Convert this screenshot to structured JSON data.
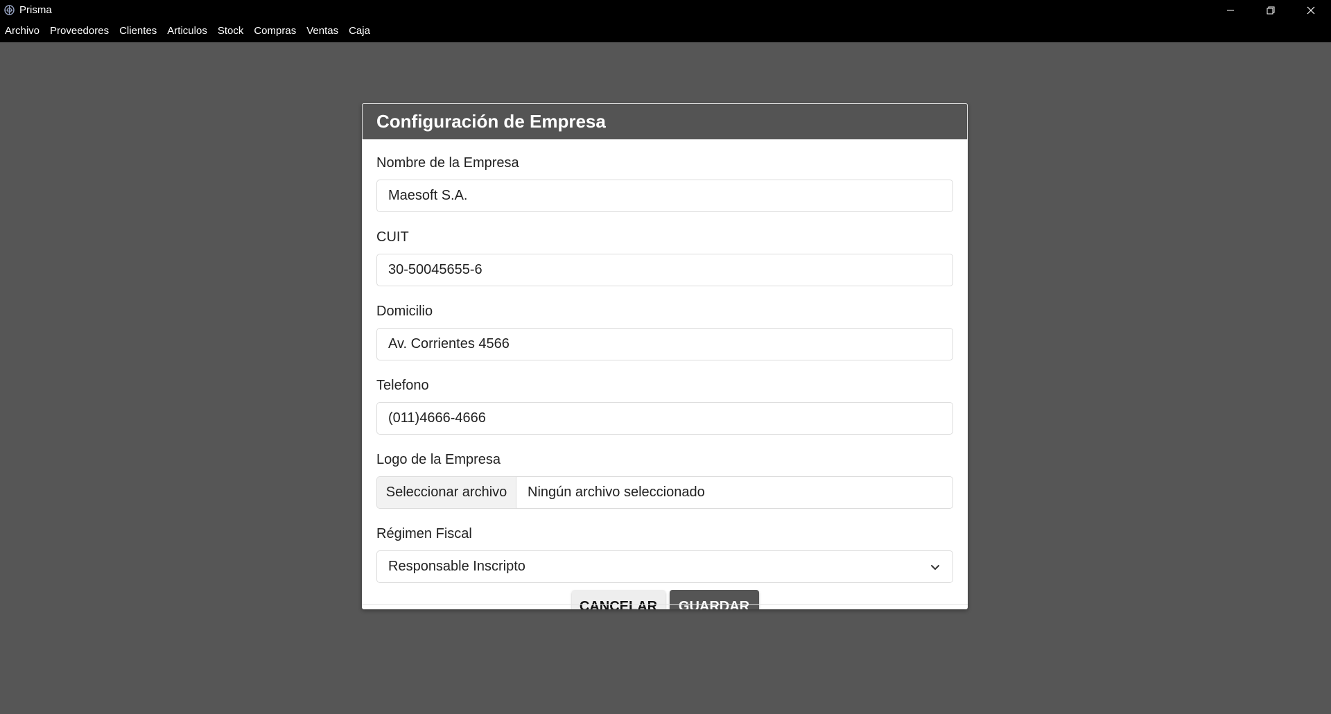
{
  "window": {
    "title": "Prisma",
    "controls": [
      "minimize",
      "restore",
      "close"
    ]
  },
  "menu": {
    "items": [
      "Archivo",
      "Proveedores",
      "Clientes",
      "Articulos",
      "Stock",
      "Compras",
      "Ventas",
      "Caja"
    ]
  },
  "modal": {
    "title": "Configuración de Empresa",
    "fields": {
      "nombre": {
        "label": "Nombre de la Empresa",
        "value": "Maesoft S.A."
      },
      "cuit": {
        "label": "CUIT",
        "value": "30-50045655-6"
      },
      "domicilio": {
        "label": "Domicilio",
        "value": "Av. Corrientes 4566"
      },
      "telefono": {
        "label": "Telefono",
        "value": "(011)4666-4666"
      },
      "logo": {
        "label": "Logo de la Empresa",
        "button": "Seleccionar archivo",
        "status": "Ningún archivo seleccionado"
      },
      "regimen": {
        "label": "Régimen Fiscal",
        "selected": "Responsable Inscripto"
      }
    },
    "actions": {
      "cancel": "CANCELAR",
      "save": "GUARDAR"
    }
  },
  "colors": {
    "titlebar": "#000000",
    "background": "#565656",
    "modal_header": "#545454",
    "save_button": "#555555",
    "cancel_button": "#eeeeee"
  }
}
